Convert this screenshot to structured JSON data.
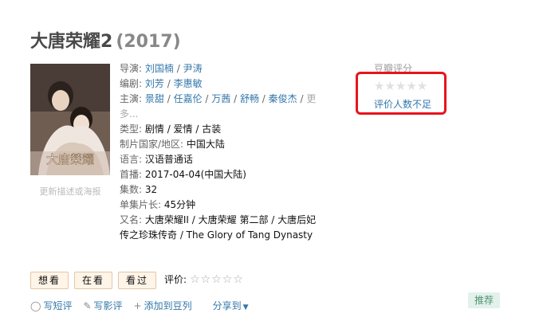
{
  "movie": {
    "title": "大唐荣耀2",
    "year": "(2017)"
  },
  "poster": {
    "overlay_text": "大唐榮耀",
    "update_link": "更新描述或海报"
  },
  "info": {
    "director_label": "导演:",
    "directors": [
      "刘国楠",
      "尹涛"
    ],
    "writer_label": "编剧:",
    "writers": [
      "刘芳",
      "李惠敏"
    ],
    "cast_label": "主演:",
    "cast": [
      "景甜",
      "任嘉伦",
      "万茜",
      "舒畅",
      "秦俊杰"
    ],
    "cast_more": "更多...",
    "genre_label": "类型:",
    "genre_value": "剧情 / 爱情 / 古装",
    "country_label": "制片国家/地区:",
    "country_value": "中国大陆",
    "language_label": "语言:",
    "language_value": "汉语普通话",
    "release_label": "首播:",
    "release_value": "2017-04-04(中国大陆)",
    "episodes_label": "集数:",
    "episodes_value": "32",
    "runtime_label": "单集片长:",
    "runtime_value": "45分钟",
    "aka_label": "又名:",
    "aka_value": "大唐荣耀II / 大唐荣耀 第二部 / 大唐后妃传之珍珠传奇 / The Glory of Tang Dynasty"
  },
  "rating": {
    "label": "豆瓣评分",
    "stars": "★★★★★",
    "note": "评价人数不足",
    "highlight_color": "#e8141c"
  },
  "actions": {
    "want": "想看",
    "watching": "在看",
    "watched": "看过",
    "rate_label": "评价:",
    "rate_stars": "☆☆☆☆☆"
  },
  "bottom": {
    "short_review": "写短评",
    "review": "写影评",
    "add_list": "添加到豆列",
    "share": "分享到",
    "recommend": "推荐"
  },
  "colors": {
    "link": "#3377aa",
    "button_bg": "#fff4e8",
    "recommend_bg": "#e3f1ed"
  }
}
